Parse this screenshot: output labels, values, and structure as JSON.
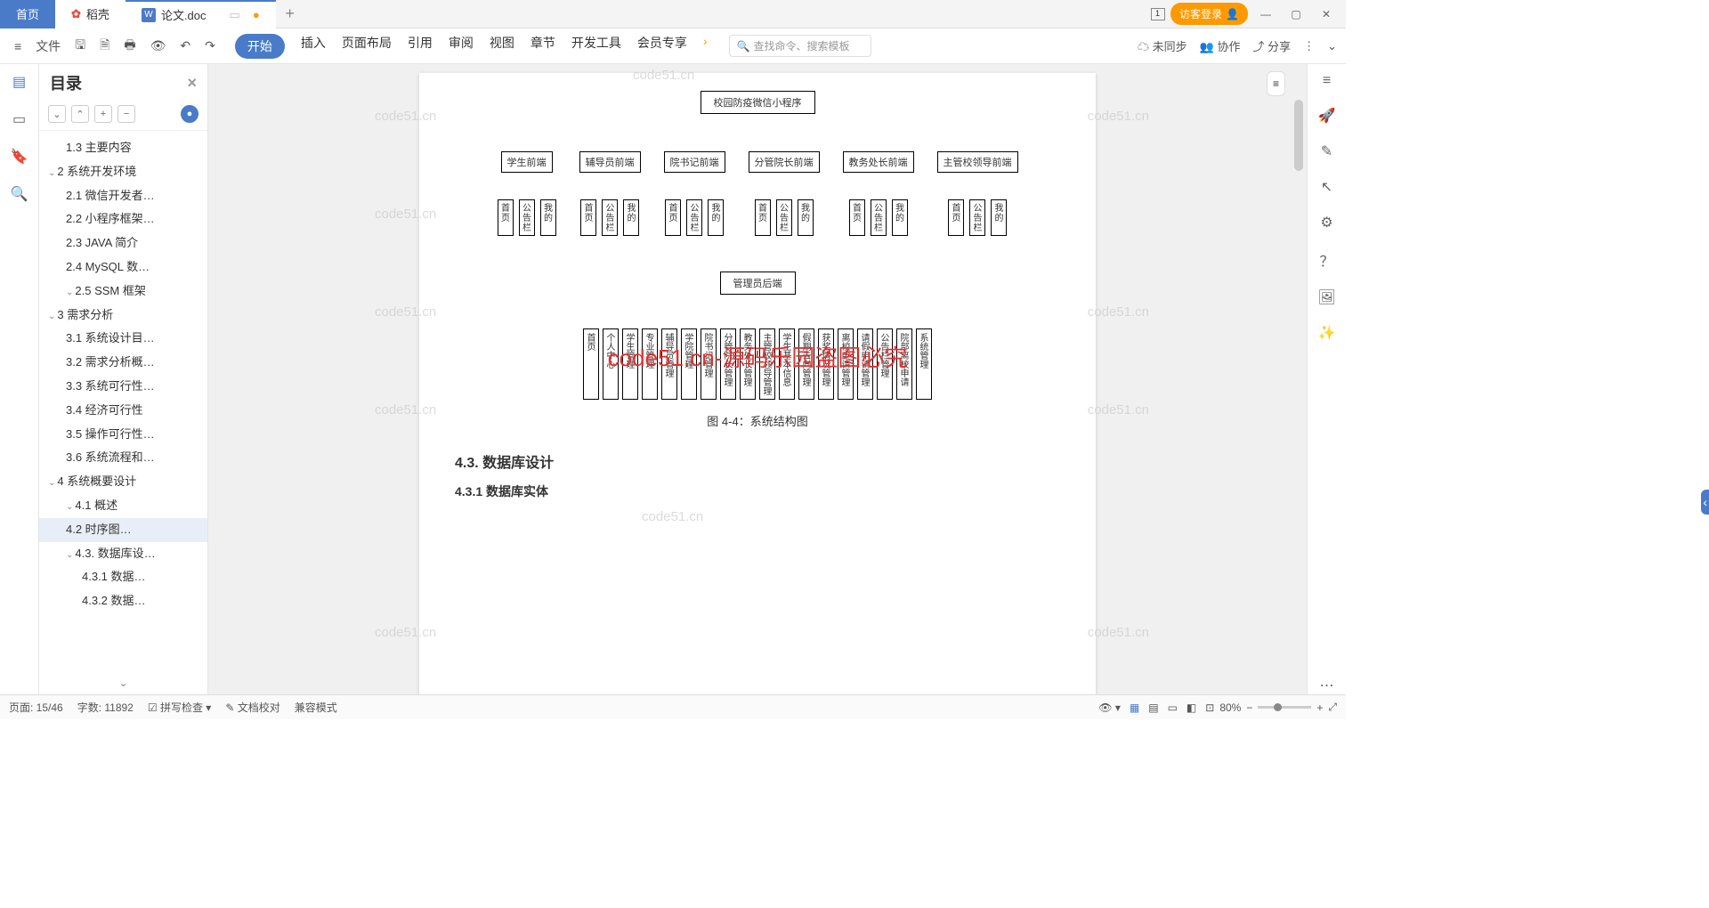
{
  "tabs": {
    "home": "首页",
    "docker": "稻壳",
    "active": "论文.doc"
  },
  "login": "访客登录",
  "file_label": "文件",
  "menu": [
    "开始",
    "插入",
    "页面布局",
    "引用",
    "审阅",
    "视图",
    "章节",
    "开发工具",
    "会员专享"
  ],
  "search_placeholder": "查找命令、搜索模板",
  "sync": "未同步",
  "collab": "协作",
  "share": "分享",
  "outline_title": "目录",
  "outline": [
    {
      "l": 2,
      "t": "1.3 主要内容"
    },
    {
      "l": 1,
      "t": "2 系统开发环境",
      "c": 1
    },
    {
      "l": 2,
      "t": "2.1 微信开发者…"
    },
    {
      "l": 2,
      "t": "2.2 小程序框架…"
    },
    {
      "l": 2,
      "t": "2.3 JAVA 简介"
    },
    {
      "l": 2,
      "t": "2.4 MySQL 数…"
    },
    {
      "l": 2,
      "t": "2.5 SSM 框架",
      "c": 1
    },
    {
      "l": 1,
      "t": "3 需求分析",
      "c": 1
    },
    {
      "l": 2,
      "t": "3.1 系统设计目…"
    },
    {
      "l": 2,
      "t": "3.2 需求分析概…"
    },
    {
      "l": 2,
      "t": "3.3 系统可行性…"
    },
    {
      "l": 2,
      "t": "3.4 经济可行性"
    },
    {
      "l": 2,
      "t": "3.5 操作可行性…"
    },
    {
      "l": 2,
      "t": "3.6 系统流程和…"
    },
    {
      "l": 1,
      "t": "4 系统概要设计",
      "c": 1
    },
    {
      "l": 2,
      "t": "4.1 概述",
      "c": 1
    },
    {
      "l": 2,
      "t": "4.2 时序图…",
      "sel": 1
    },
    {
      "l": 2,
      "t": "4.3. 数据库设…",
      "c": 1
    },
    {
      "l": 3,
      "t": "4.3.1 数据…"
    },
    {
      "l": 3,
      "t": "4.3.2 数据…"
    }
  ],
  "diagram": {
    "root": "校园防疫微信小程序",
    "fronts": [
      "学生前端",
      "辅导员前端",
      "院书记前端",
      "分管院长前端",
      "教务处长前端",
      "主管校领导前端"
    ],
    "leaves": [
      "首页",
      "公告栏",
      "我的"
    ],
    "admin": "管理员后端",
    "admin_leaves": [
      "首页",
      "个人中心",
      "学生管理",
      "专业管理",
      "辅导员管理",
      "学院管理",
      "院书记管理",
      "分管院长管理",
      "教务处长管理",
      "主管校领导管理",
      "学生基本信息",
      "假期去向管理",
      "获奖情况管理",
      "离校申请管理",
      "请假申请管理",
      "公告栏管理",
      "院部离校申请",
      "系统管理"
    ]
  },
  "caption": "图 4-4：系统结构图",
  "section43": "4.3. 数据库设计",
  "section431": "4.3.1 数据库实体",
  "watermark": "code51.cn",
  "watermark_red": "code51.cn-源码乐园盗图必究",
  "status": {
    "page": "页面: 15/46",
    "words": "字数: 11892",
    "spell": "拼写检查",
    "proof": "文档校对",
    "compat": "兼容模式",
    "zoom": "80%"
  }
}
